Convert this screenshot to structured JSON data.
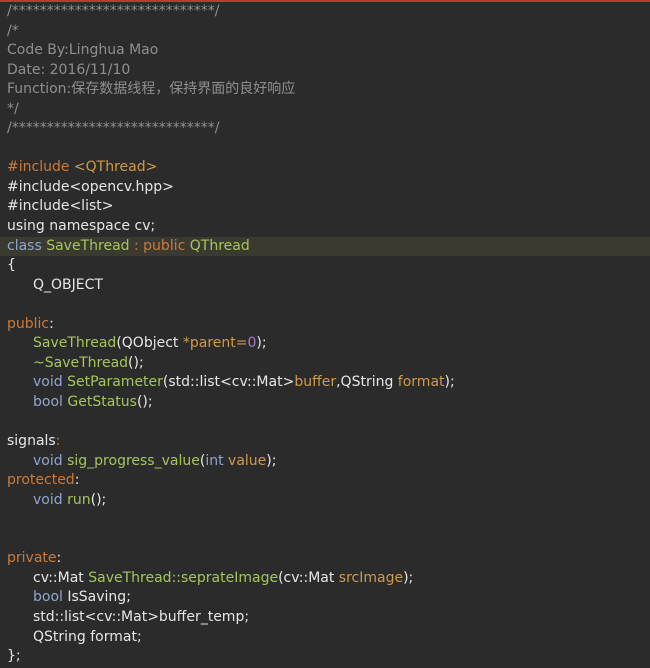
{
  "editor": {
    "lines": {
      "l1": "/*****************************/",
      "l2": "/*",
      "l3": "Code By:Linghua Mao",
      "l4": "Date: 2016/11/10",
      "l5": "Function:保存数据线程，保持界面的良好响应",
      "l6": "*/",
      "l7": "/*****************************/",
      "l9_dir": "#include",
      "l9_arg": "<QThread>",
      "l10": "#include<opencv.hpp>",
      "l11": "#include<list>",
      "l12": "using namespace cv;",
      "l13_kw": "class",
      "l13_name": "SaveThread",
      "l13_colon": ":",
      "l13_pub": "public",
      "l13_base": "QThread",
      "l14": "{",
      "l15": "Q_OBJECT",
      "l17_kw": "public",
      "l17_colon": ":",
      "l18_fn": "SaveThread",
      "l18_a": "(QObject ",
      "l18_param": "*parent=",
      "l18_num": "0",
      "l18_b": ");",
      "l19": "~SaveThread",
      "l19_b": "();",
      "l20_type": "void",
      "l20_fn": "SetParameter",
      "l20_a": "(std::list<cv::Mat>",
      "l20_p1": "buffer",
      "l20_b": ",QString ",
      "l20_p2": "format",
      "l20_c": ");",
      "l21_type": "bool",
      "l21_fn": "GetStatus",
      "l21_b": "();",
      "l23_kw": "signals",
      "l23_colon": ":",
      "l24_type": "void",
      "l24_fn": "sig_progress_value",
      "l24_a": "(",
      "l24_int": "int",
      "l24_param": "value",
      "l24_b": ");",
      "l25_kw": "protected",
      "l25_colon": ":",
      "l26_type": "void",
      "l26_fn": "run",
      "l26_b": "();",
      "l29_kw": "private",
      "l29_colon": ":",
      "l30_a": "cv::Mat ",
      "l30_fn": "SaveThread::seprateImage",
      "l30_b": "(cv::Mat ",
      "l30_param": "srcImage",
      "l30_c": ");",
      "l31_type": "bool",
      "l31_b": " IsSaving;",
      "l32": "std::list<cv::Mat>buffer_temp;",
      "l33": "QString format;",
      "l34": "};"
    }
  },
  "colors": {
    "background": "#2b2b2b",
    "comment": "#8f8f8f",
    "keyword": "#cc7a3a",
    "type": "#8fa6d0",
    "class_function": "#a6c65a",
    "number": "#a37acc",
    "current_line": "#3a3a31",
    "top_border": "#c0392b"
  }
}
